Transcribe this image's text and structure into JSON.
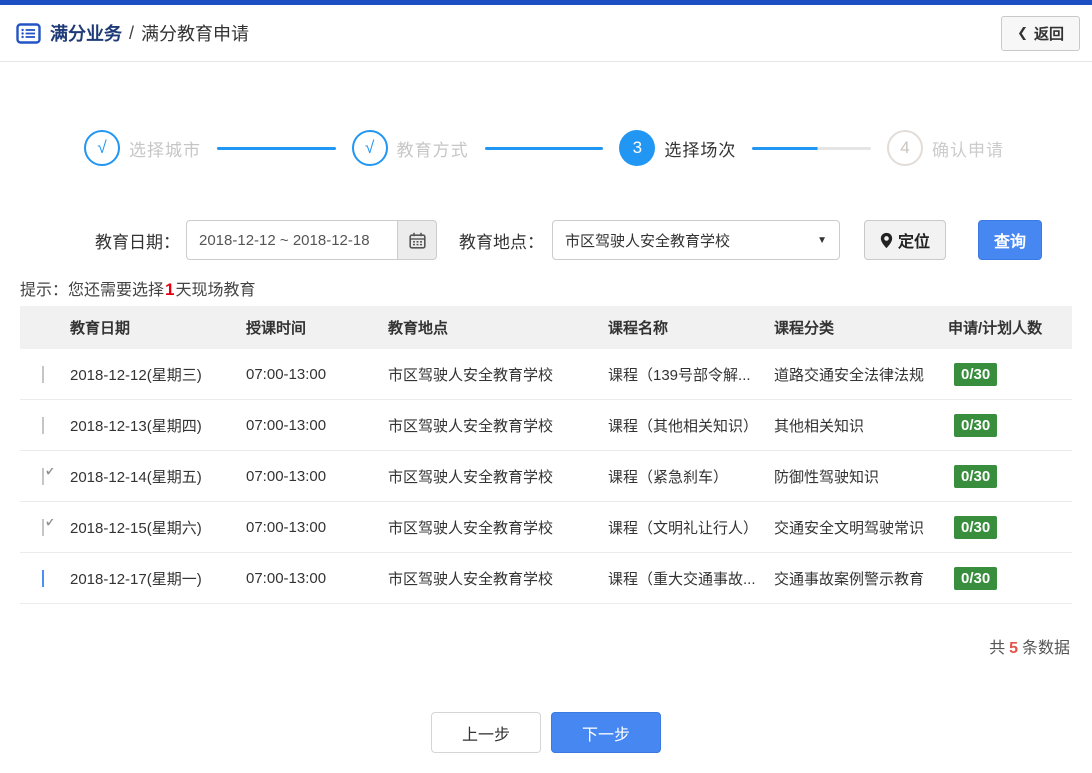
{
  "header": {
    "breadcrumb_root": "满分业务",
    "breadcrumb_separator": "/",
    "breadcrumb_current": "满分教育申请",
    "back_label": "返回"
  },
  "stepper": {
    "steps": [
      {
        "label": "选择城市",
        "symbol": "√",
        "status": "done"
      },
      {
        "label": "教育方式",
        "symbol": "√",
        "status": "done"
      },
      {
        "label": "选择场次",
        "symbol": "3",
        "status": "active"
      },
      {
        "label": "确认申请",
        "symbol": "4",
        "status": "pending"
      }
    ]
  },
  "filters": {
    "date_label": "教育日期：",
    "date_value": "2018-12-12 ~ 2018-12-18",
    "location_label": "教育地点：",
    "location_value": "市区驾驶人安全教育学校",
    "locate_button": "定位",
    "search_button": "查询"
  },
  "hint": {
    "prefix": "提示：您还需要选择",
    "highlight": "1",
    "suffix": "天现场教育"
  },
  "table": {
    "columns": [
      "教育日期",
      "授课时间",
      "教育地点",
      "课程名称",
      "课程分类",
      "申请/计划人数"
    ],
    "rows": [
      {
        "checked": false,
        "focused": false,
        "date": "2018-12-12(星期三)",
        "time": "07:00-13:00",
        "location": "市区驾驶人安全教育学校",
        "course": "课程（139号部令解...",
        "category": "道路交通安全法律法规",
        "count": "0/30"
      },
      {
        "checked": false,
        "focused": false,
        "date": "2018-12-13(星期四)",
        "time": "07:00-13:00",
        "location": "市区驾驶人安全教育学校",
        "course": "课程（其他相关知识）",
        "category": "其他相关知识",
        "count": "0/30"
      },
      {
        "checked": true,
        "focused": false,
        "date": "2018-12-14(星期五)",
        "time": "07:00-13:00",
        "location": "市区驾驶人安全教育学校",
        "course": "课程（紧急刹车）",
        "category": "防御性驾驶知识",
        "count": "0/30"
      },
      {
        "checked": true,
        "focused": false,
        "date": "2018-12-15(星期六)",
        "time": "07:00-13:00",
        "location": "市区驾驶人安全教育学校",
        "course": "课程（文明礼让行人）",
        "category": "交通安全文明驾驶常识",
        "count": "0/30"
      },
      {
        "checked": false,
        "focused": true,
        "date": "2018-12-17(星期一)",
        "time": "07:00-13:00",
        "location": "市区驾驶人安全教育学校",
        "course": "课程（重大交通事故...",
        "category": "交通事故案例警示教育",
        "count": "0/30"
      }
    ]
  },
  "footer": {
    "total_prefix": "共",
    "total_count": "5",
    "total_suffix": "条数据"
  },
  "actions": {
    "prev_button": "上一步",
    "next_button": "下一步"
  },
  "icons": {
    "back_chevron": "❮",
    "select_caret": "▼",
    "checkbox_check": "✓"
  },
  "colors": {
    "brand_blue": "#1d4fc4",
    "accent_blue": "#2196f3",
    "button_blue": "#4687f2",
    "badge_green": "#388e3c",
    "hint_red": "#e60012",
    "count_red": "#e0544c"
  }
}
